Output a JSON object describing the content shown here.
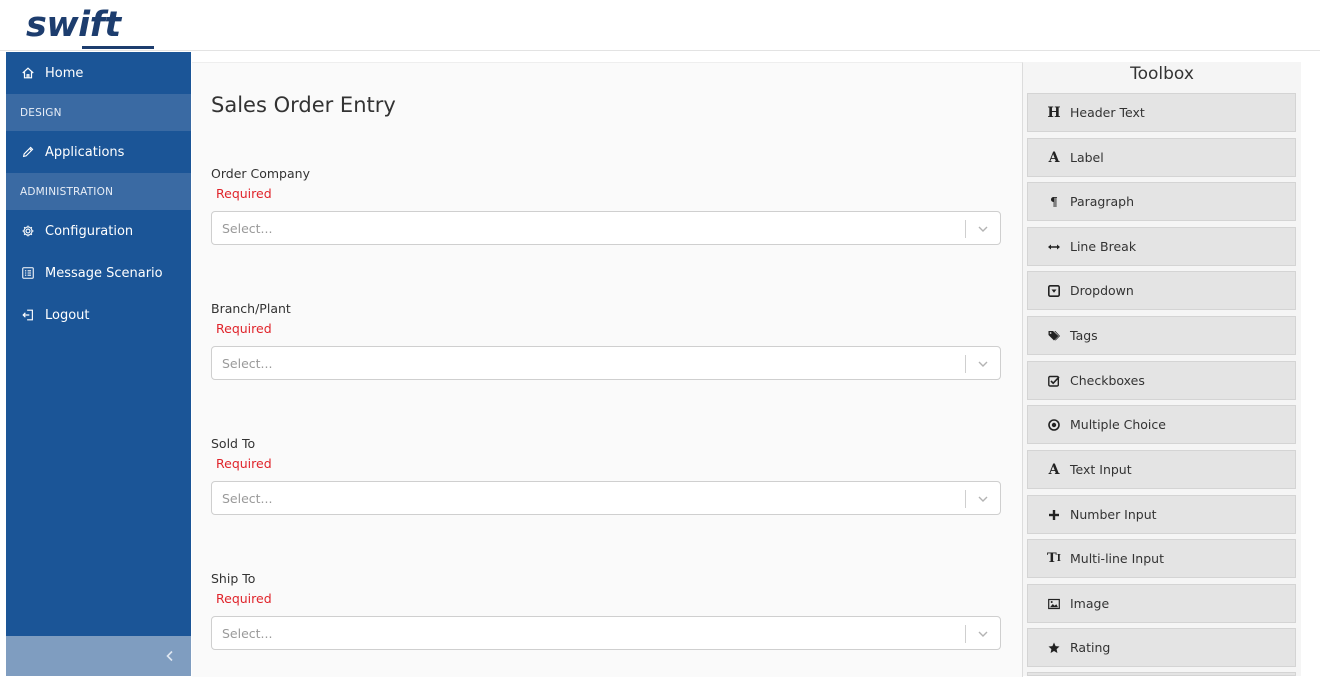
{
  "app": {
    "logo_text": "swift"
  },
  "sidebar": {
    "home": "Home",
    "section_design": "DESIGN",
    "applications": "Applications",
    "section_admin": "ADMINISTRATION",
    "configuration": "Configuration",
    "message_scenario": "Message Scenario",
    "logout": "Logout"
  },
  "form": {
    "title": "Sales Order Entry",
    "fields": [
      {
        "label": "Order Company",
        "required": "Required",
        "placeholder": "Select..."
      },
      {
        "label": "Branch/Plant",
        "required": "Required",
        "placeholder": "Select..."
      },
      {
        "label": "Sold To",
        "required": "Required",
        "placeholder": "Select..."
      },
      {
        "label": "Ship To",
        "required": "Required",
        "placeholder": "Select..."
      }
    ]
  },
  "toolbox": {
    "title": "Toolbox",
    "items": [
      {
        "label": "Header Text",
        "icon": "header-icon"
      },
      {
        "label": "Label",
        "icon": "label-icon"
      },
      {
        "label": "Paragraph",
        "icon": "paragraph-icon"
      },
      {
        "label": "Line Break",
        "icon": "line-break-icon"
      },
      {
        "label": "Dropdown",
        "icon": "dropdown-icon"
      },
      {
        "label": "Tags",
        "icon": "tags-icon"
      },
      {
        "label": "Checkboxes",
        "icon": "checkbox-icon"
      },
      {
        "label": "Multiple Choice",
        "icon": "radio-icon"
      },
      {
        "label": "Text Input",
        "icon": "text-input-icon"
      },
      {
        "label": "Number Input",
        "icon": "plus-icon"
      },
      {
        "label": "Multi-line Input",
        "icon": "multiline-icon"
      },
      {
        "label": "Image",
        "icon": "image-icon"
      },
      {
        "label": "Rating",
        "icon": "star-icon"
      }
    ]
  },
  "colors": {
    "sidebar_bg": "#1b5597",
    "section_bg": "#3a6aa3",
    "required": "#e0242b",
    "logo": "#1d3d6e"
  }
}
